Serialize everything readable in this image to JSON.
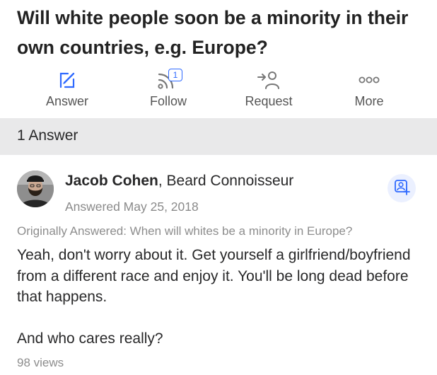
{
  "question": {
    "title": "Will white people soon be a minority in their own countries, e.g. Europe?"
  },
  "actions": [
    {
      "label": "Answer",
      "icon": "pencil-square-icon"
    },
    {
      "label": "Follow",
      "icon": "rss-feed-icon",
      "badge": "1"
    },
    {
      "label": "Request",
      "icon": "request-user-icon"
    },
    {
      "label": "More",
      "icon": "more-dots-icon"
    }
  ],
  "answer_count": "1 Answer",
  "answer": {
    "author_name": "Jacob Cohen",
    "author_credential": ", Beard Connoisseur",
    "date": "Answered May 25, 2018",
    "originally_answered": "Originally Answered: When will whites be a minority in Europe?",
    "paragraphs": [
      "Yeah, don't worry about it. Get yourself a girlfriend/boyfriend from a different race and enjoy it. You'll be long dead before that happens.",
      "And who cares really?"
    ],
    "views": "98 views"
  },
  "colors": {
    "accent": "#2e69ff",
    "bar_bg": "#e9e9ea",
    "muted_text": "#8d8d8d"
  }
}
